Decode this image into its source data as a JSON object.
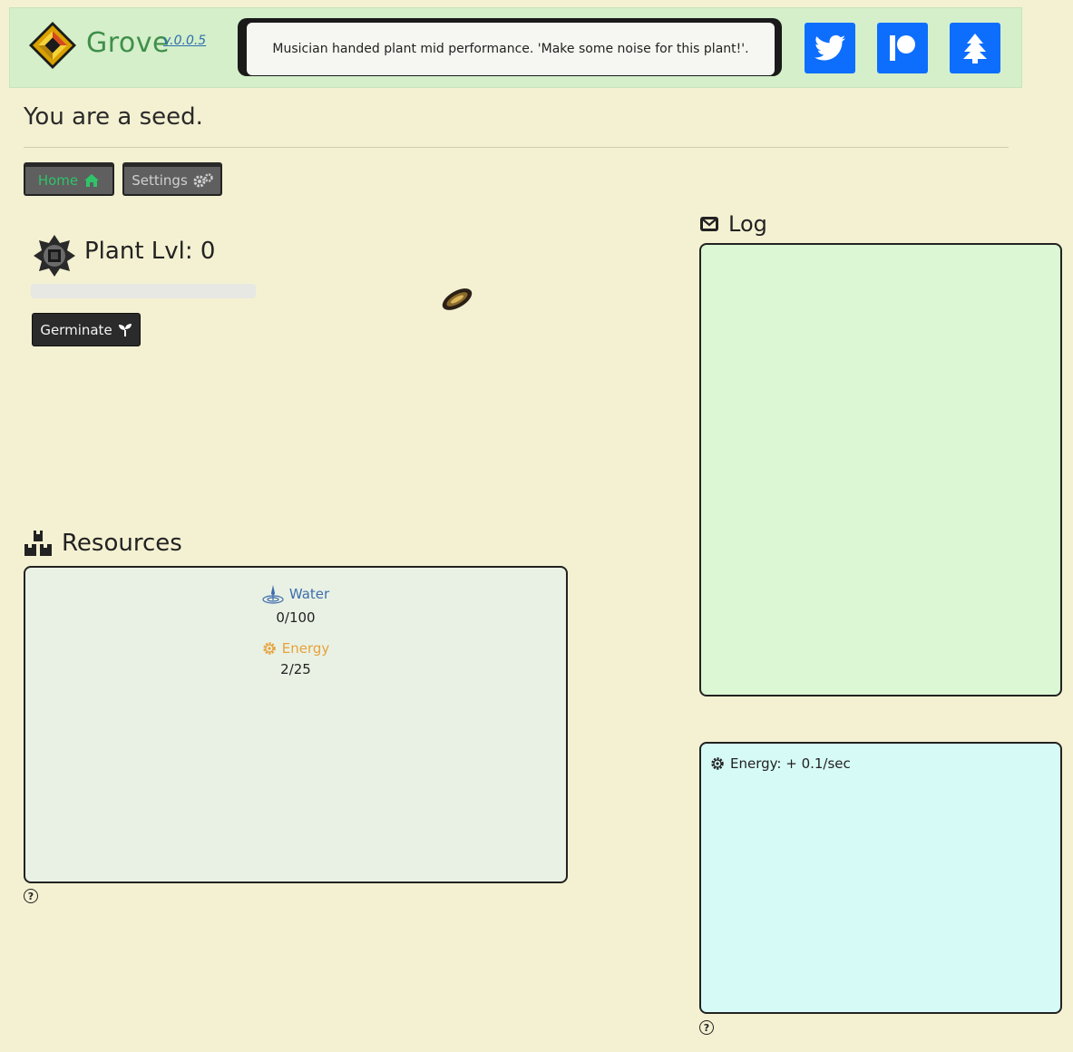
{
  "header": {
    "brand": "Grove",
    "version": "v.0.0.5",
    "ticker_message": "Musician handed plant mid performance. 'Make some noise for this plant!'.",
    "social": [
      "twitter-icon",
      "patreon-icon",
      "tree-icon"
    ],
    "brand_color": "#3f8f4a",
    "social_color": "#0d6efd"
  },
  "page": {
    "title": "You are a seed."
  },
  "tabs": {
    "home": "Home",
    "settings": "Settings"
  },
  "plant": {
    "level_label": "Plant Lvl: 0",
    "progress_fraction": 0,
    "germinate_label": "Germinate"
  },
  "resources": {
    "heading": "Resources",
    "items": [
      {
        "name": "Water",
        "value": "0/100",
        "color": "#3d6dad",
        "icon": "water-drop-icon"
      },
      {
        "name": "Energy",
        "value": "2/25",
        "color": "#e6a23c",
        "icon": "gear-icon"
      }
    ]
  },
  "log": {
    "heading": "Log"
  },
  "energy_panel": {
    "rate": "Energy: + 0.1/sec"
  },
  "help": "?"
}
